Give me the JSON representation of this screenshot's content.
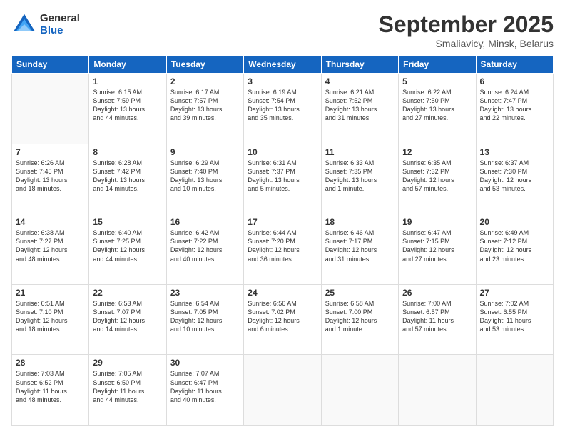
{
  "logo": {
    "line1": "General",
    "line2": "Blue"
  },
  "title": "September 2025",
  "location": "Smaliavicy, Minsk, Belarus",
  "weekdays": [
    "Sunday",
    "Monday",
    "Tuesday",
    "Wednesday",
    "Thursday",
    "Friday",
    "Saturday"
  ],
  "weeks": [
    [
      {
        "num": "",
        "info": ""
      },
      {
        "num": "1",
        "info": "Sunrise: 6:15 AM\nSunset: 7:59 PM\nDaylight: 13 hours\nand 44 minutes."
      },
      {
        "num": "2",
        "info": "Sunrise: 6:17 AM\nSunset: 7:57 PM\nDaylight: 13 hours\nand 39 minutes."
      },
      {
        "num": "3",
        "info": "Sunrise: 6:19 AM\nSunset: 7:54 PM\nDaylight: 13 hours\nand 35 minutes."
      },
      {
        "num": "4",
        "info": "Sunrise: 6:21 AM\nSunset: 7:52 PM\nDaylight: 13 hours\nand 31 minutes."
      },
      {
        "num": "5",
        "info": "Sunrise: 6:22 AM\nSunset: 7:50 PM\nDaylight: 13 hours\nand 27 minutes."
      },
      {
        "num": "6",
        "info": "Sunrise: 6:24 AM\nSunset: 7:47 PM\nDaylight: 13 hours\nand 22 minutes."
      }
    ],
    [
      {
        "num": "7",
        "info": "Sunrise: 6:26 AM\nSunset: 7:45 PM\nDaylight: 13 hours\nand 18 minutes."
      },
      {
        "num": "8",
        "info": "Sunrise: 6:28 AM\nSunset: 7:42 PM\nDaylight: 13 hours\nand 14 minutes."
      },
      {
        "num": "9",
        "info": "Sunrise: 6:29 AM\nSunset: 7:40 PM\nDaylight: 13 hours\nand 10 minutes."
      },
      {
        "num": "10",
        "info": "Sunrise: 6:31 AM\nSunset: 7:37 PM\nDaylight: 13 hours\nand 5 minutes."
      },
      {
        "num": "11",
        "info": "Sunrise: 6:33 AM\nSunset: 7:35 PM\nDaylight: 13 hours\nand 1 minute."
      },
      {
        "num": "12",
        "info": "Sunrise: 6:35 AM\nSunset: 7:32 PM\nDaylight: 12 hours\nand 57 minutes."
      },
      {
        "num": "13",
        "info": "Sunrise: 6:37 AM\nSunset: 7:30 PM\nDaylight: 12 hours\nand 53 minutes."
      }
    ],
    [
      {
        "num": "14",
        "info": "Sunrise: 6:38 AM\nSunset: 7:27 PM\nDaylight: 12 hours\nand 48 minutes."
      },
      {
        "num": "15",
        "info": "Sunrise: 6:40 AM\nSunset: 7:25 PM\nDaylight: 12 hours\nand 44 minutes."
      },
      {
        "num": "16",
        "info": "Sunrise: 6:42 AM\nSunset: 7:22 PM\nDaylight: 12 hours\nand 40 minutes."
      },
      {
        "num": "17",
        "info": "Sunrise: 6:44 AM\nSunset: 7:20 PM\nDaylight: 12 hours\nand 36 minutes."
      },
      {
        "num": "18",
        "info": "Sunrise: 6:46 AM\nSunset: 7:17 PM\nDaylight: 12 hours\nand 31 minutes."
      },
      {
        "num": "19",
        "info": "Sunrise: 6:47 AM\nSunset: 7:15 PM\nDaylight: 12 hours\nand 27 minutes."
      },
      {
        "num": "20",
        "info": "Sunrise: 6:49 AM\nSunset: 7:12 PM\nDaylight: 12 hours\nand 23 minutes."
      }
    ],
    [
      {
        "num": "21",
        "info": "Sunrise: 6:51 AM\nSunset: 7:10 PM\nDaylight: 12 hours\nand 18 minutes."
      },
      {
        "num": "22",
        "info": "Sunrise: 6:53 AM\nSunset: 7:07 PM\nDaylight: 12 hours\nand 14 minutes."
      },
      {
        "num": "23",
        "info": "Sunrise: 6:54 AM\nSunset: 7:05 PM\nDaylight: 12 hours\nand 10 minutes."
      },
      {
        "num": "24",
        "info": "Sunrise: 6:56 AM\nSunset: 7:02 PM\nDaylight: 12 hours\nand 6 minutes."
      },
      {
        "num": "25",
        "info": "Sunrise: 6:58 AM\nSunset: 7:00 PM\nDaylight: 12 hours\nand 1 minute."
      },
      {
        "num": "26",
        "info": "Sunrise: 7:00 AM\nSunset: 6:57 PM\nDaylight: 11 hours\nand 57 minutes."
      },
      {
        "num": "27",
        "info": "Sunrise: 7:02 AM\nSunset: 6:55 PM\nDaylight: 11 hours\nand 53 minutes."
      }
    ],
    [
      {
        "num": "28",
        "info": "Sunrise: 7:03 AM\nSunset: 6:52 PM\nDaylight: 11 hours\nand 48 minutes."
      },
      {
        "num": "29",
        "info": "Sunrise: 7:05 AM\nSunset: 6:50 PM\nDaylight: 11 hours\nand 44 minutes."
      },
      {
        "num": "30",
        "info": "Sunrise: 7:07 AM\nSunset: 6:47 PM\nDaylight: 11 hours\nand 40 minutes."
      },
      {
        "num": "",
        "info": ""
      },
      {
        "num": "",
        "info": ""
      },
      {
        "num": "",
        "info": ""
      },
      {
        "num": "",
        "info": ""
      }
    ]
  ]
}
